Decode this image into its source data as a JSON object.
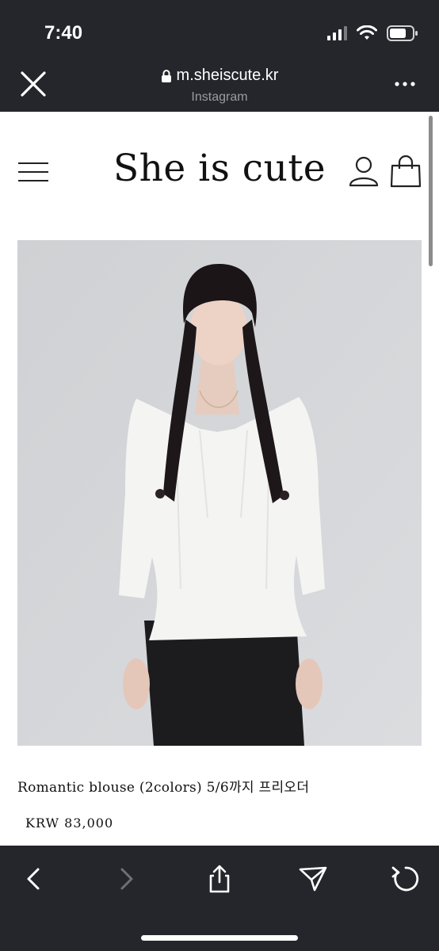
{
  "status_bar": {
    "time": "7:40",
    "battery_level": 0.7
  },
  "browser": {
    "url": "m.sheiscute.kr",
    "source": "Instagram"
  },
  "site": {
    "logo": "She is cute"
  },
  "product": {
    "title": "Romantic blouse (2colors) 5/6까지 프리오더",
    "price": "KRW 83,000"
  },
  "toolbar": {
    "icons": [
      "back-icon",
      "forward-icon",
      "share-icon",
      "send-icon",
      "reload-icon"
    ]
  },
  "colors": {
    "chrome": "#24262b",
    "page": "#ffffff",
    "photo_bg": "#d4d6d9",
    "disabled": "#6e7076"
  }
}
